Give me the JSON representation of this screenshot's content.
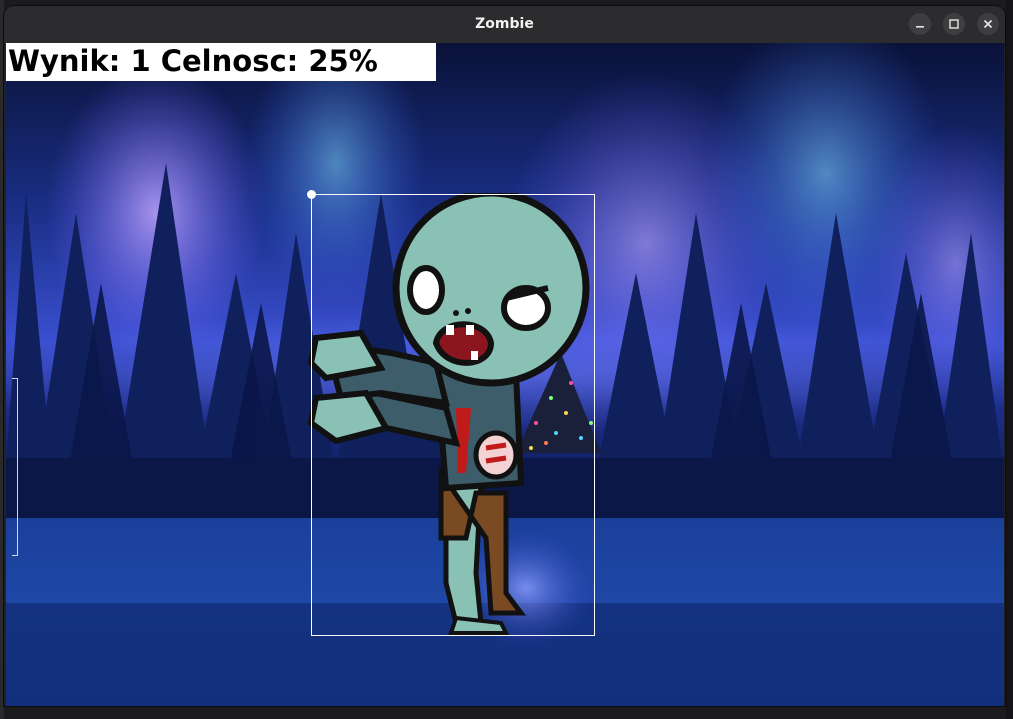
{
  "window": {
    "title": "Zombie",
    "controls": [
      "minimize",
      "maximize",
      "close"
    ]
  },
  "hud": {
    "score_text": "Wynik: 1 Celnosc: 25%"
  },
  "colors": {
    "sky_top": "#0b1440",
    "aurora_purple": "#a98cff",
    "forest": "#0f1e4a",
    "water": "#1e4aa8",
    "zombie_skin": "#89c2b4",
    "zombie_shirt": "#3d5d6a",
    "zombie_pants": "#7a4a22",
    "hitbox": "#ffffff"
  },
  "icons": {
    "minimize": "minimize-icon",
    "maximize": "maximize-icon",
    "close": "close-icon"
  }
}
